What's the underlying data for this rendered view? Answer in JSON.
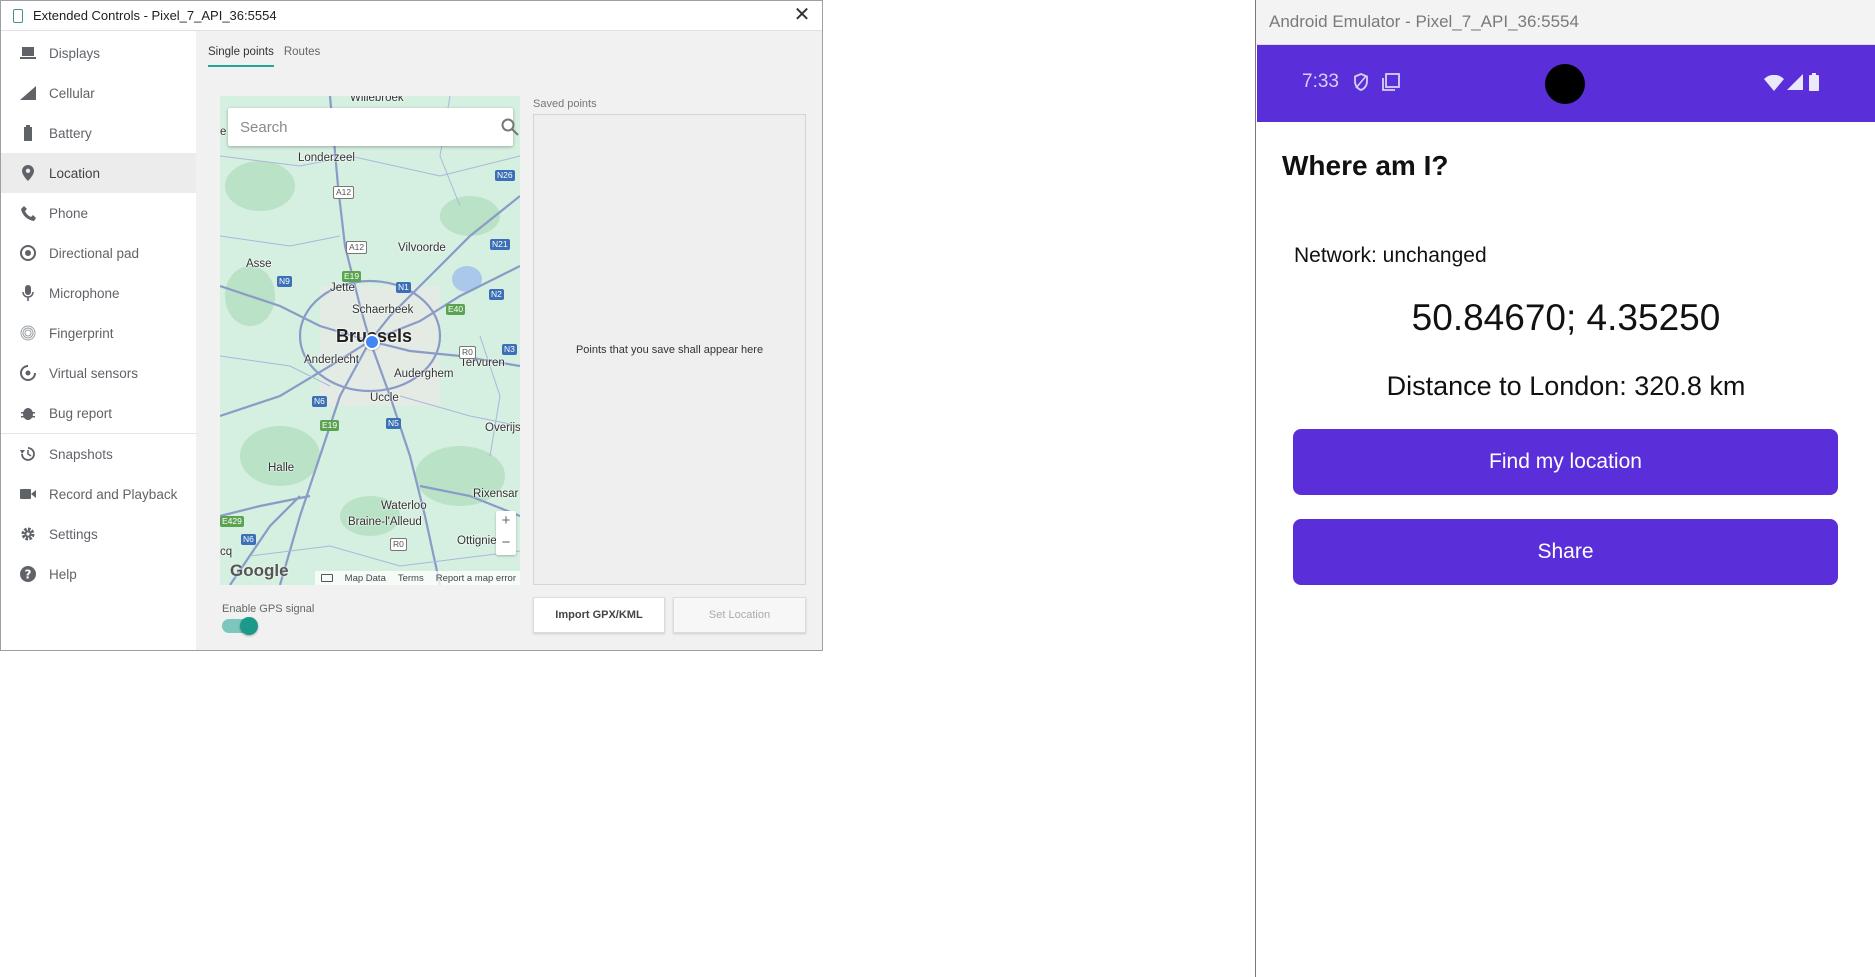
{
  "extended_controls": {
    "title": "Extended Controls - Pixel_7_API_36:5554",
    "close_label": "✕",
    "sidebar": {
      "items": [
        {
          "label": "Displays",
          "icon": "display-icon"
        },
        {
          "label": "Cellular",
          "icon": "cellular-icon"
        },
        {
          "label": "Battery",
          "icon": "battery-icon"
        },
        {
          "label": "Location",
          "icon": "location-pin-icon",
          "active": true
        },
        {
          "label": "Phone",
          "icon": "phone-icon"
        },
        {
          "label": "Directional pad",
          "icon": "dpad-icon"
        },
        {
          "label": "Microphone",
          "icon": "microphone-icon"
        },
        {
          "label": "Fingerprint",
          "icon": "fingerprint-icon"
        },
        {
          "label": "Virtual sensors",
          "icon": "sensors-icon"
        },
        {
          "label": "Bug report",
          "icon": "bug-icon"
        },
        {
          "label": "Snapshots",
          "icon": "snapshots-icon"
        },
        {
          "label": "Record and Playback",
          "icon": "video-camera-icon"
        },
        {
          "label": "Settings",
          "icon": "gear-icon"
        },
        {
          "label": "Help",
          "icon": "help-icon"
        }
      ]
    },
    "tabs": [
      {
        "label": "Single points",
        "active": true
      },
      {
        "label": "Routes",
        "active": false
      }
    ],
    "map": {
      "search_placeholder": "Search",
      "labels": {
        "willebroek": "Willebroek",
        "londerzeel": "Londerzeel",
        "vilvoorde": "Vilvoorde",
        "asse": "Asse",
        "jette": "Jette",
        "schaerbeek": "Schaerbeek",
        "brussels": "Brussels",
        "anderlecht": "Anderlecht",
        "auderghem": "Auderghem",
        "tervuren": "Tervuren",
        "uccle": "Uccle",
        "overijse": "Overijs",
        "halle": "Halle",
        "rixensart": "Rixensar",
        "waterloo": "Waterloo",
        "braine": "Braine-l'Alleud",
        "ottignies": "Ottignie",
        "edge_e": "e",
        "edge_cq": "cq"
      },
      "shields": {
        "a12a": "A12",
        "a12b": "A12",
        "n26": "N26",
        "n21": "N21",
        "n9": "N9",
        "e19a": "E19",
        "n1": "N1",
        "n2": "N2",
        "e40": "E40",
        "r0a": "R0",
        "n3": "N3",
        "n6a": "N6",
        "n5": "N5",
        "e19b": "E19",
        "e429": "E429",
        "n6b": "N6",
        "r0b": "R0"
      },
      "google_logo": "Google",
      "zoom_in": "+",
      "zoom_out": "−",
      "footer": {
        "map_data": "Map Data",
        "terms": "Terms",
        "report": "Report a map error"
      }
    },
    "gps_label": "Enable GPS signal",
    "gps_enabled": true,
    "saved_points_label": "Saved points",
    "saved_points_empty": "Points that you save shall appear here",
    "import_button": "Import GPX/KML",
    "set_location_button": "Set Location"
  },
  "emulator": {
    "title": "Android Emulator - Pixel_7_API_36:5554",
    "status_bar": {
      "time": "7:33",
      "color": "#5a2fd9"
    },
    "app": {
      "title": "Where am I?",
      "network": "Network: unchanged",
      "coordinates": "50.84670; 4.35250",
      "distance": "Distance to London: 320.8 km",
      "find_button": "Find my location",
      "share_button": "Share"
    }
  }
}
